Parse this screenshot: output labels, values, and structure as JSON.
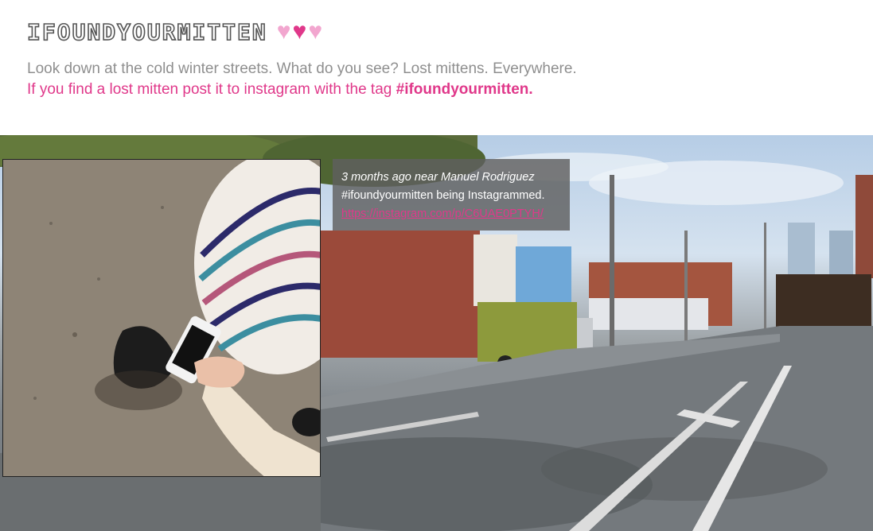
{
  "site": {
    "logo_text": "IFOUNDYOURMITTEN",
    "hearts": [
      "♥",
      "♥",
      "♥"
    ]
  },
  "intro": {
    "description": "Look down at the cold winter streets. What do you see? Lost mittens. Everywhere.",
    "cta_text": "If you find a lost mitten post it to instagram with the tag ",
    "cta_tag": "#ifoundyourmitten."
  },
  "post": {
    "meta": "3 months ago near Manuel Rodriguez",
    "text": "#ifoundyourmitten being Instagrammed.",
    "link": "https://instagram.com/p/C6UAE0PTYH/"
  },
  "colors": {
    "accent": "#e0388a",
    "heart_light": "#f2a6cf",
    "heart_dark": "#e0388a",
    "description": "#8f8f8f"
  }
}
